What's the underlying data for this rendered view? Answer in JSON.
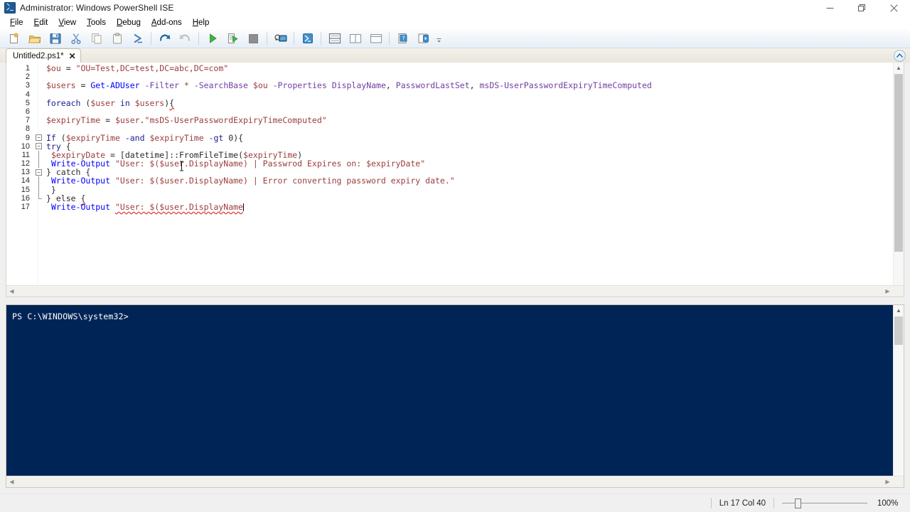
{
  "window": {
    "title": "Administrator: Windows PowerShell ISE",
    "app_icon": "powershell-icon",
    "minimize_label": "Minimize",
    "restore_label": "Restore",
    "close_label": "Close"
  },
  "menubar": {
    "items": [
      {
        "label": "File",
        "accel": "F"
      },
      {
        "label": "Edit",
        "accel": "E"
      },
      {
        "label": "View",
        "accel": "V"
      },
      {
        "label": "Tools",
        "accel": "T"
      },
      {
        "label": "Debug",
        "accel": "D"
      },
      {
        "label": "Add-ons",
        "accel": "A"
      },
      {
        "label": "Help",
        "accel": "H"
      }
    ]
  },
  "toolbar": {
    "buttons": [
      {
        "name": "new-script-icon",
        "tooltip": "New"
      },
      {
        "name": "open-script-icon",
        "tooltip": "Open"
      },
      {
        "name": "save-icon",
        "tooltip": "Save"
      },
      {
        "name": "cut-icon",
        "tooltip": "Cut"
      },
      {
        "name": "copy-icon",
        "tooltip": "Copy"
      },
      {
        "name": "paste-icon",
        "tooltip": "Paste"
      },
      {
        "name": "clear-console-icon",
        "tooltip": "Clear Console Pane"
      },
      {
        "name": "undo-icon",
        "tooltip": "Undo"
      },
      {
        "name": "redo-icon",
        "tooltip": "Redo"
      },
      {
        "name": "run-script-icon",
        "tooltip": "Run Script"
      },
      {
        "name": "run-selection-icon",
        "tooltip": "Run Selection"
      },
      {
        "name": "stop-operation-icon",
        "tooltip": "Stop Operation"
      },
      {
        "name": "new-remote-tab-icon",
        "tooltip": "New Remote PowerShell Tab"
      },
      {
        "name": "start-powershell-exe-icon",
        "tooltip": "Start PowerShell.exe"
      },
      {
        "name": "show-script-pane-top-icon",
        "tooltip": "Show Script Pane Top"
      },
      {
        "name": "show-script-pane-right-icon",
        "tooltip": "Show Script Pane Right"
      },
      {
        "name": "show-script-pane-max-icon",
        "tooltip": "Show Script Pane Maximized"
      },
      {
        "name": "show-command-addon-icon",
        "tooltip": "Show Command Add-on"
      },
      {
        "name": "show-commands-pane-icon",
        "tooltip": "Show Commands Pane"
      },
      {
        "name": "toolbar-overflow-icon",
        "tooltip": "More"
      }
    ]
  },
  "tab": {
    "label": "Untitled2.ps1*",
    "close_glyph": "✕"
  },
  "pane_collapse": {
    "name": "collapse-script-pane-icon",
    "glyph": "▲"
  },
  "editor": {
    "lines": [
      {
        "n": "1",
        "fold": "",
        "tokens": [
          {
            "t": "$ou",
            "c": "t-var"
          },
          {
            "t": " = ",
            "c": "t-op"
          },
          {
            "t": "\"OU=Test,DC=test,DC=abc,DC=com\"",
            "c": "t-str"
          }
        ]
      },
      {
        "n": "2",
        "fold": "",
        "tokens": []
      },
      {
        "n": "3",
        "fold": "",
        "tokens": [
          {
            "t": "$users",
            "c": "t-var"
          },
          {
            "t": " = ",
            "c": "t-op"
          },
          {
            "t": "Get-ADUser",
            "c": "t-cmd"
          },
          {
            "t": " ",
            "c": "t-op"
          },
          {
            "t": "-Filter",
            "c": "t-parm"
          },
          {
            "t": " ",
            "c": "t-op"
          },
          {
            "t": "*",
            "c": "t-str"
          },
          {
            "t": " ",
            "c": "t-op"
          },
          {
            "t": "-SearchBase",
            "c": "t-parm"
          },
          {
            "t": " ",
            "c": "t-op"
          },
          {
            "t": "$ou",
            "c": "t-var"
          },
          {
            "t": " ",
            "c": "t-op"
          },
          {
            "t": "-Properties",
            "c": "t-parm"
          },
          {
            "t": " ",
            "c": "t-op"
          },
          {
            "t": "DisplayName",
            "c": "t-parm"
          },
          {
            "t": ", ",
            "c": "t-op"
          },
          {
            "t": "PasswordLastSet",
            "c": "t-parm"
          },
          {
            "t": ", ",
            "c": "t-op"
          },
          {
            "t": "msDS-UserPasswordExpiryTimeComputed",
            "c": "t-parm"
          }
        ]
      },
      {
        "n": "4",
        "fold": "",
        "tokens": []
      },
      {
        "n": "5",
        "fold": "",
        "tokens": [
          {
            "t": "foreach",
            "c": "t-kw"
          },
          {
            "t": " (",
            "c": "t-op"
          },
          {
            "t": "$user",
            "c": "t-var"
          },
          {
            "t": " ",
            "c": "t-op"
          },
          {
            "t": "in",
            "c": "t-kw"
          },
          {
            "t": " ",
            "c": "t-op"
          },
          {
            "t": "$users",
            "c": "t-var"
          },
          {
            "t": ")",
            "c": "t-op"
          },
          {
            "t": "{",
            "c": "t-op squig"
          }
        ]
      },
      {
        "n": "6",
        "fold": "",
        "tokens": []
      },
      {
        "n": "7",
        "fold": "",
        "tokens": [
          {
            "t": "$expiryTime",
            "c": "t-var"
          },
          {
            "t": " = ",
            "c": "t-op"
          },
          {
            "t": "$user",
            "c": "t-var"
          },
          {
            "t": ".",
            "c": "t-op"
          },
          {
            "t": "\"msDS-UserPasswordExpiryTimeComputed\"",
            "c": "t-str"
          }
        ]
      },
      {
        "n": "8",
        "fold": "",
        "tokens": []
      },
      {
        "n": "9",
        "fold": "box",
        "tokens": [
          {
            "t": "If",
            "c": "t-kw"
          },
          {
            "t": " (",
            "c": "t-op"
          },
          {
            "t": "$expiryTime",
            "c": "t-var"
          },
          {
            "t": " ",
            "c": "t-op"
          },
          {
            "t": "-and",
            "c": "t-kw"
          },
          {
            "t": " ",
            "c": "t-op"
          },
          {
            "t": "$expiryTime",
            "c": "t-var"
          },
          {
            "t": " ",
            "c": "t-op"
          },
          {
            "t": "-gt",
            "c": "t-kw"
          },
          {
            "t": " 0){",
            "c": "t-op"
          }
        ]
      },
      {
        "n": "10",
        "fold": "box",
        "tokens": [
          {
            "t": "try",
            "c": "t-kw"
          },
          {
            "t": " {",
            "c": "t-op"
          }
        ]
      },
      {
        "n": "11",
        "fold": "line",
        "tokens": [
          {
            "t": " ",
            "c": "t-op"
          },
          {
            "t": "$expiryDate",
            "c": "t-var"
          },
          {
            "t": " = ",
            "c": "t-op"
          },
          {
            "t": "[datetime]",
            "c": "t-type"
          },
          {
            "t": "::",
            "c": "t-op"
          },
          {
            "t": "FromFileTime",
            "c": "t-plain"
          },
          {
            "t": "(",
            "c": "t-op"
          },
          {
            "t": "$expiryTime",
            "c": "t-var"
          },
          {
            "t": ")",
            "c": "t-op"
          }
        ]
      },
      {
        "n": "12",
        "fold": "line",
        "tokens": [
          {
            "t": " ",
            "c": "t-op"
          },
          {
            "t": "Write-Output",
            "c": "t-cmd"
          },
          {
            "t": " ",
            "c": "t-op"
          },
          {
            "t": "\"User: $($user.DisplayName) | Passwrod Expires on: $expiryDate\"",
            "c": "t-str"
          }
        ]
      },
      {
        "n": "13",
        "fold": "box",
        "tokens": [
          {
            "t": "} catch {",
            "c": "t-op"
          }
        ]
      },
      {
        "n": "14",
        "fold": "line",
        "tokens": [
          {
            "t": " ",
            "c": "t-op"
          },
          {
            "t": "Write-Output",
            "c": "t-cmd"
          },
          {
            "t": " ",
            "c": "t-op"
          },
          {
            "t": "\"User: $($user.DisplayName) | Error converting password expiry date.\"",
            "c": "t-str"
          }
        ]
      },
      {
        "n": "15",
        "fold": "line",
        "tokens": [
          {
            "t": " }",
            "c": "t-op"
          }
        ]
      },
      {
        "n": "16",
        "fold": "end",
        "tokens": [
          {
            "t": "} else ",
            "c": "t-op"
          },
          {
            "t": "{",
            "c": "t-op squig"
          }
        ]
      },
      {
        "n": "17",
        "fold": "",
        "tokens": [
          {
            "t": " ",
            "c": "t-op"
          },
          {
            "t": "Write-Output",
            "c": "t-cmd"
          },
          {
            "t": " ",
            "c": "t-op"
          },
          {
            "t": "\"User: $($user.DisplayName",
            "c": "t-str squig"
          }
        ],
        "caret": true
      }
    ]
  },
  "console": {
    "prompt": "PS C:\\WINDOWS\\system32>",
    "background": "#012456"
  },
  "statusbar": {
    "position": "Ln 17  Col 40",
    "zoom_percent": "100%",
    "zoom_value": 100
  },
  "colors": {
    "console_bg": "#012456",
    "variable": "#9b3d3d",
    "cmdlet": "#0000ff",
    "parameter": "#6e3fa3",
    "error_squiggle": "#dd3333",
    "accent": "#0078d7"
  }
}
